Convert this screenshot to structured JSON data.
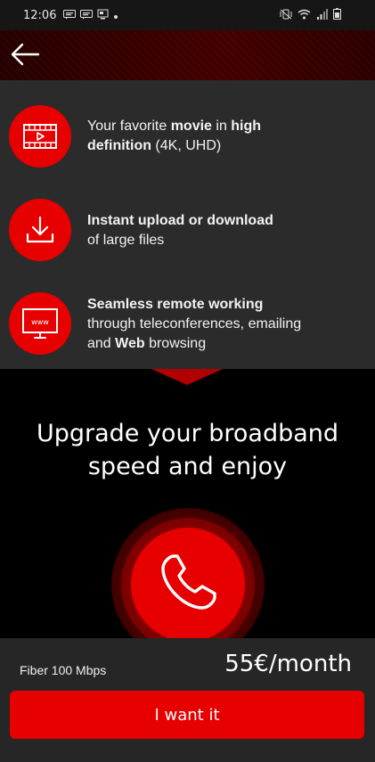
{
  "status_bar": {
    "time": "12:06",
    "left_icons": [
      "message-icon",
      "message-icon",
      "screenshot-icon",
      "dot-icon"
    ],
    "right_icons": [
      "vibrate-mute-icon",
      "wifi-icon",
      "signal-icon",
      "battery-icon"
    ]
  },
  "header": {
    "back_icon": "back-arrow-icon"
  },
  "features": [
    {
      "icon": "movie-icon",
      "line1_parts": [
        "Your favorite ",
        "movie",
        " in ",
        "high"
      ],
      "line2_parts": [
        "definition",
        " (4K, UHD)"
      ]
    },
    {
      "icon": "download-icon",
      "line1": "Instant upload or download",
      "line2": "of large files"
    },
    {
      "icon": "www-monitor-icon",
      "line1": "Seamless remote working",
      "line2": "through teleconferences, emailing",
      "line3_parts": [
        "and ",
        "Web",
        " browsing"
      ]
    }
  ],
  "promo": {
    "title_line1": "Upgrade your broadband",
    "title_line2": "speed and enjoy",
    "call_icon": "phone-icon"
  },
  "plan": {
    "name": "Fiber 100 Mbps",
    "price": "55€/month"
  },
  "cta": {
    "label": "I want it"
  },
  "colors": {
    "accent": "#e60000",
    "card_bg": "#2b2b2b",
    "bottom_bg": "#262626"
  }
}
